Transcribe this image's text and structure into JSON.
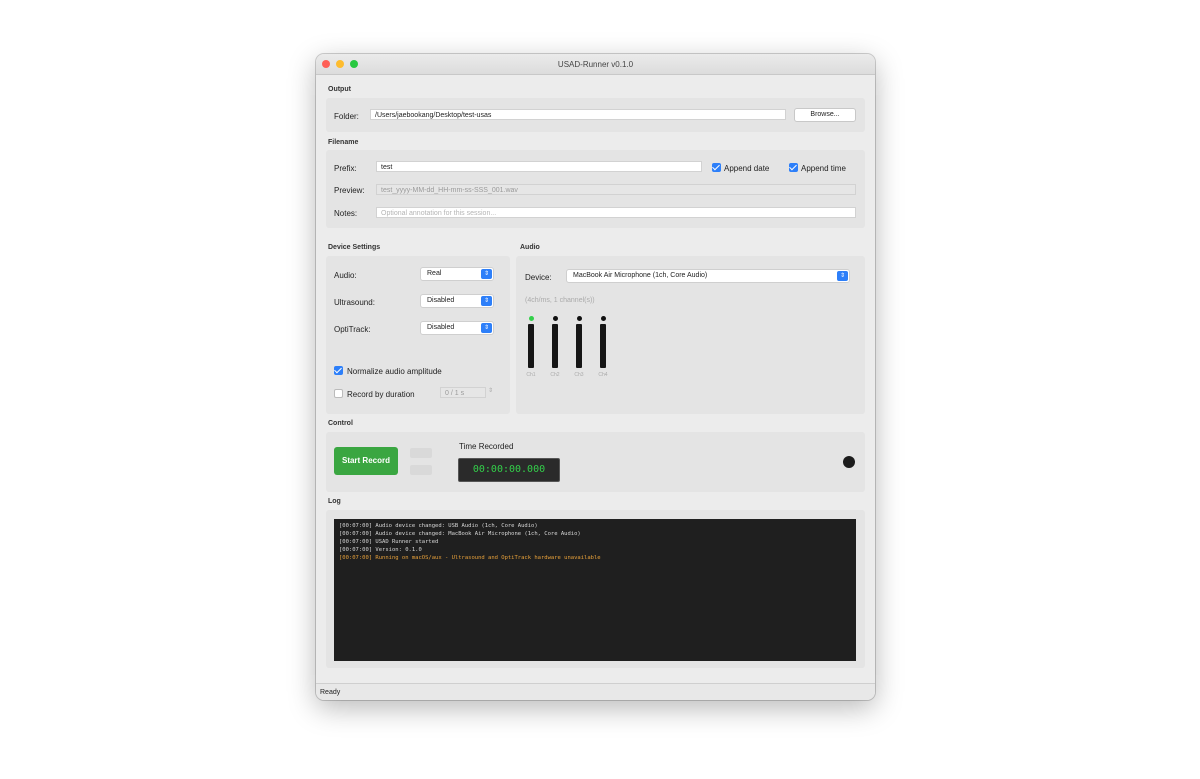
{
  "window": {
    "title": "USAD-Runner v0.1.0"
  },
  "output": {
    "section": "Output",
    "folder_label": "Folder:",
    "folder_value": "/Users/jaebookang/Desktop/test-usas",
    "browse_label": "Browse..."
  },
  "filename": {
    "section": "Filename",
    "prefix_label": "Prefix:",
    "prefix_value": "test",
    "append_date_label": "Append date",
    "append_time_label": "Append time",
    "preview_label": "Preview:",
    "preview_value": "test_yyyy-MM-dd_HH-mm-ss-SSS_001.wav",
    "notes_label": "Notes:",
    "notes_placeholder": "Optional annotation for this session..."
  },
  "device_settings": {
    "section": "Device Settings",
    "rows": [
      {
        "label": "Audio:",
        "value": "Real"
      },
      {
        "label": "Ultrasound:",
        "value": "Disabled"
      },
      {
        "label": "OptiTrack:",
        "value": "Disabled"
      }
    ],
    "normalize_label": "Normalize audio amplitude",
    "record_duration_label": "Record by duration",
    "duration_value": "0 / 1 s"
  },
  "audio": {
    "section": "Audio",
    "device_label": "Device:",
    "device_value": "MacBook Air Microphone (1ch, Core Audio)",
    "channel_info": "(4ch/ms, 1 channel(s))",
    "meters": [
      {
        "label": "Ch1",
        "color": "#33d04a"
      },
      {
        "label": "Ch2",
        "color": "#111111"
      },
      {
        "label": "Ch3",
        "color": "#111111"
      },
      {
        "label": "Ch4",
        "color": "#111111"
      }
    ]
  },
  "control": {
    "section": "Control",
    "start_label": "Start Record",
    "time_label": "Time Recorded",
    "time_value": "00:00:00.000"
  },
  "log": {
    "section": "Log",
    "lines": [
      {
        "text": "[00:07:00] Audio device changed: USB Audio (1ch, Core Audio)",
        "warn": false
      },
      {
        "text": "[00:07:00] Audio device changed: MacBook Air Microphone (1ch, Core Audio)",
        "warn": false
      },
      {
        "text": "[00:07:00] USAD Runner started",
        "warn": false
      },
      {
        "text": "[00:07:00] Version: 0.1.0",
        "warn": false
      },
      {
        "text": "[00:07:00] Running on macOS/aux - Ultrasound and OptiTrack hardware unavailable",
        "warn": true
      }
    ]
  },
  "status": {
    "text": "Ready"
  }
}
